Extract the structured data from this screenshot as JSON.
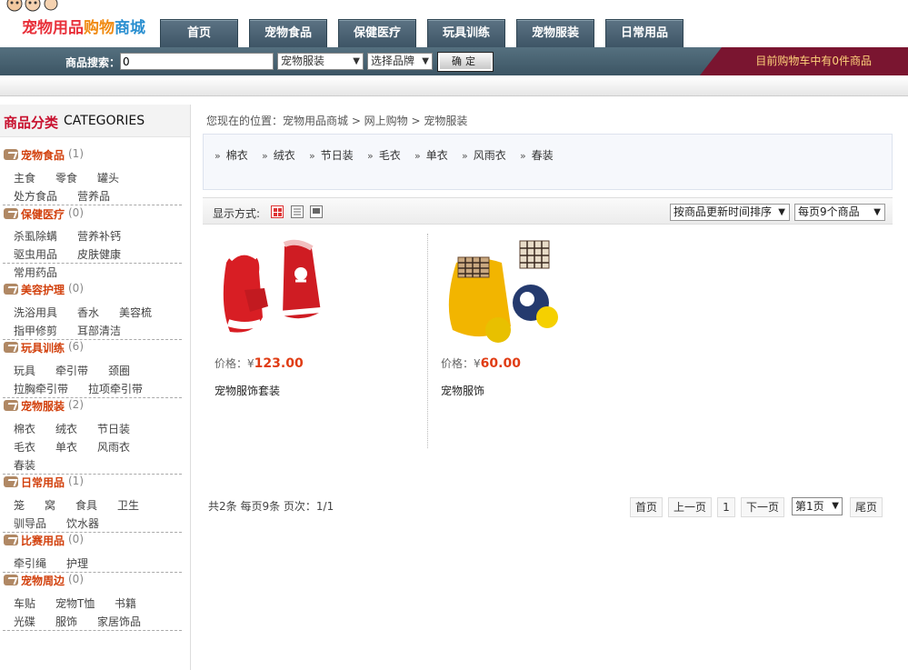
{
  "logo": {
    "text": "宠物用品购物商城"
  },
  "nav": {
    "tabs": [
      "首页",
      "宠物食品",
      "保健医疗",
      "玩具训练",
      "宠物服装",
      "日常用品"
    ]
  },
  "search": {
    "label": "商品搜索：",
    "value": "0",
    "category_selected": "宠物服装",
    "brand_selected": "选择品牌",
    "button_label": "确定"
  },
  "cart": {
    "text": "目前购物车中有0件商品"
  },
  "sidebar": {
    "heading_cn": "商品分类",
    "heading_en": "CATEGORIES",
    "categories": [
      {
        "name": "宠物食品",
        "count": "(1)",
        "items": [
          "主食",
          "零食",
          "罐头",
          "处方食品",
          "营养品"
        ]
      },
      {
        "name": "保健医疗",
        "count": "(0)",
        "items": [
          "杀虱除螨",
          "营养补钙",
          "驱虫用品",
          "皮肤健康",
          "常用药品"
        ]
      },
      {
        "name": "美容护理",
        "count": "(0)",
        "items": [
          "洗浴用具",
          "香水",
          "美容梳",
          "指甲修剪",
          "耳部清洁"
        ]
      },
      {
        "name": "玩具训练",
        "count": "(6)",
        "items": [
          "玩具",
          "牵引带",
          "颈圈",
          "拉胸牵引带",
          "拉项牵引带"
        ]
      },
      {
        "name": "宠物服装",
        "count": "(2)",
        "items": [
          "棉衣",
          "绒衣",
          "节日装",
          "毛衣",
          "单衣",
          "风雨衣",
          "春装"
        ]
      },
      {
        "name": "日常用品",
        "count": "(1)",
        "items": [
          "笼",
          "窝",
          "食具",
          "卫生",
          "驯导品",
          "饮水器"
        ]
      },
      {
        "name": "比赛用品",
        "count": "(0)",
        "items": [
          "牵引绳",
          "护理"
        ]
      },
      {
        "name": "宠物周边",
        "count": "(0)",
        "items": [
          "车贴",
          "宠物T恤",
          "书籍",
          "光碟",
          "服饰",
          "家居饰品"
        ]
      }
    ]
  },
  "breadcrumb": {
    "text": "您现在的位置：宠物用品商城 > 网上购物 > 宠物服装"
  },
  "subcategories": [
    "棉衣",
    "绒衣",
    "节日装",
    "毛衣",
    "单衣",
    "风雨衣",
    "春装"
  ],
  "toolbar": {
    "display_label": "显示方式:",
    "sort_selected": "按商品更新时间排序",
    "per_page_selected": "每页9个商品"
  },
  "products": [
    {
      "price_label": "价格：",
      "currency": "¥",
      "price": "123.00",
      "name": "宠物服饰套装"
    },
    {
      "price_label": "价格：",
      "currency": "¥",
      "price": "60.00",
      "name": "宠物服饰"
    }
  ],
  "pagination": {
    "info": "共2条 每页9条 页次：1/1",
    "first": "首页",
    "prev": "上一页",
    "current": "1",
    "next": "下一页",
    "page_select": "第1页",
    "last": "尾页"
  },
  "colors": {
    "nav_bg": "#4a6272",
    "cart_bg": "#7a1530",
    "accent_red": "#e03c14",
    "category_orange": "#d2400c"
  }
}
